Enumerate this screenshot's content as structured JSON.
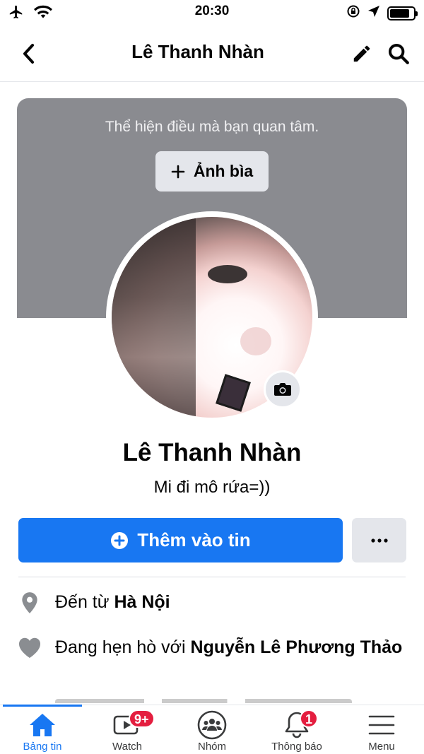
{
  "status_bar": {
    "time": "20:30",
    "icons": [
      "airplane-icon",
      "wifi-icon",
      "rotation-lock-icon",
      "location-icon",
      "battery-icon"
    ],
    "battery_level": 0.85
  },
  "nav": {
    "title": "Lê Thanh Nhàn",
    "icons": [
      "back-icon",
      "edit-icon",
      "search-icon"
    ]
  },
  "cover": {
    "hint": "Thể hiện điều mà bạn quan tâm.",
    "button_label": "Ảnh bìa",
    "background_color": "#8a8b90"
  },
  "profile": {
    "name": "Lê Thanh Nhàn",
    "bio": "Mi đi mô rứa=))"
  },
  "actions": {
    "add_story_label": "Thêm vào tin",
    "accent_color": "#1877f2"
  },
  "details": {
    "hometown_prefix": "Đến từ ",
    "hometown_value": "Hà Nội",
    "relationship_prefix": "Đang hẹn hò với ",
    "relationship_value": "Nguyễn Lê Phương Thảo"
  },
  "tabs": [
    {
      "label": "Bảng tin",
      "icon": "home-icon",
      "active": true
    },
    {
      "label": "Watch",
      "icon": "watch-icon",
      "badge": "9+"
    },
    {
      "label": "Nhóm",
      "icon": "groups-icon"
    },
    {
      "label": "Thông báo",
      "icon": "bell-icon",
      "badge": "1"
    },
    {
      "label": "Menu",
      "icon": "menu-icon"
    }
  ]
}
